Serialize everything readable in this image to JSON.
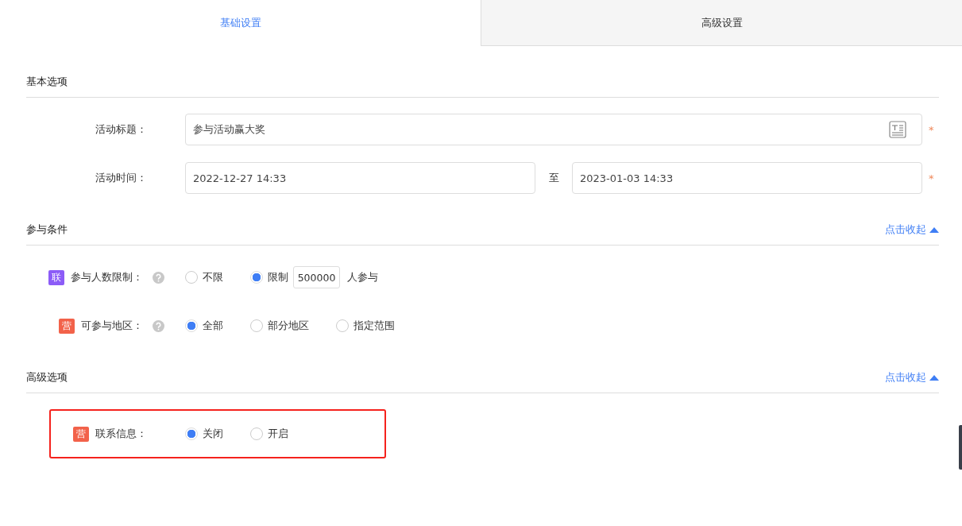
{
  "tabs": [
    {
      "label": "基础设置",
      "selected": true
    },
    {
      "label": "高级设置",
      "selected": false
    }
  ],
  "sections": [
    {
      "title": "基本选项",
      "rows": [
        {
          "kind": "text",
          "label": "活动标题：",
          "value": "参与活动赢大奖",
          "required_mark": "*"
        },
        {
          "kind": "range",
          "label": "活动时间：",
          "start": "2022-12-27 14:33",
          "separator": "至",
          "end": "2023-01-03 14:33",
          "required_mark": "*"
        }
      ]
    },
    {
      "title": "参与条件",
      "collapse_link": "点击收起",
      "rows": [
        {
          "kind": "radio",
          "badge": {
            "text": "联",
            "color": "#8c5cf7"
          },
          "label": "参与人数限制：",
          "help": true,
          "highlighted": false,
          "options": [
            {
              "label": "不限",
              "selected": false
            },
            {
              "label": "限制",
              "selected": true
            }
          ],
          "input": "500000",
          "suffix": "人参与"
        },
        {
          "kind": "radio",
          "badge": {
            "text": "营",
            "color": "#f2624a"
          },
          "label": "可参与地区：",
          "help": true,
          "highlighted": false,
          "options": [
            {
              "label": "全部",
              "selected": true
            },
            {
              "label": "部分地区",
              "selected": false
            },
            {
              "label": "指定范围",
              "selected": false
            }
          ]
        }
      ]
    },
    {
      "title": "高级选项",
      "collapse_link": "点击收起",
      "rows": [
        {
          "kind": "radio",
          "badge": {
            "text": "营",
            "color": "#f2624a"
          },
          "label": "联系信息：",
          "help": false,
          "highlighted": true,
          "options": [
            {
              "label": "关闭",
              "selected": true
            },
            {
              "label": "开启",
              "selected": false
            }
          ]
        }
      ]
    }
  ]
}
